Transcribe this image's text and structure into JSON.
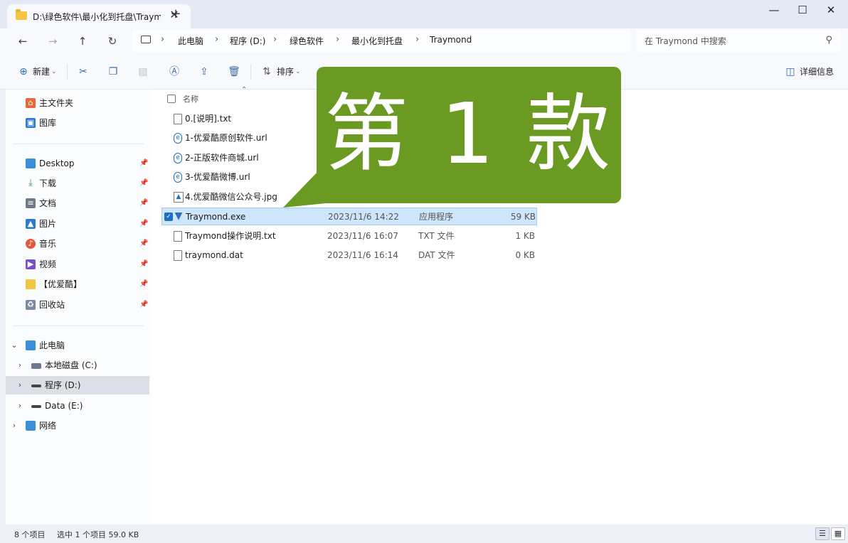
{
  "tab": {
    "title": "D:\\绿色软件\\最小化到托盘\\Traymond",
    "close": "✕",
    "new": "+"
  },
  "window": {
    "minimize": "—",
    "maximize": "☐",
    "close": "✕"
  },
  "nav": {
    "back": "←",
    "forward": "→",
    "up": "↑",
    "refresh": "↻",
    "sep": "›"
  },
  "breadcrumbs": [
    "此电脑",
    "程序 (D:)",
    "绿色软件",
    "最小化到托盘",
    "Traymond"
  ],
  "search": {
    "placeholder": "在 Traymond 中搜索",
    "icon": "⚲"
  },
  "toolbar": {
    "new_label": "新建",
    "sort_label": "排序",
    "details_label": "详细信息"
  },
  "sidebar": {
    "quick": [
      {
        "label": "主文件夹",
        "icon": "home-icon"
      },
      {
        "label": "图库",
        "icon": "gallery-icon"
      }
    ],
    "pinned": [
      {
        "label": "Desktop",
        "color": "#3a8fd8"
      },
      {
        "label": "下载",
        "color": "#2e8b57"
      },
      {
        "label": "文档",
        "color": "#6d7a8c"
      },
      {
        "label": "图片",
        "color": "#2f7ad1"
      },
      {
        "label": "音乐",
        "color": "#e2583e"
      },
      {
        "label": "视频",
        "color": "#7b4fc9"
      },
      {
        "label": "【优爱酷】",
        "color": "#f4c542"
      },
      {
        "label": "回收站",
        "color": "#7a8aa0"
      }
    ],
    "tree": [
      {
        "label": "此电脑",
        "chev": "⌄"
      },
      {
        "label": "本地磁盘 (C:)",
        "chev": "›"
      },
      {
        "label": "程序 (D:)",
        "chev": "›"
      },
      {
        "label": "Data (E:)",
        "chev": "›"
      },
      {
        "label": "网络",
        "chev": "›"
      }
    ],
    "pin_glyph": "📌"
  },
  "header": {
    "name": "名称",
    "sort_caret": "⌃"
  },
  "files": [
    {
      "name": "0.[说明].txt",
      "date": "",
      "type": "",
      "size": "",
      "icon": "txt"
    },
    {
      "name": "1-优爱酷原创软件.url",
      "date": "",
      "type": "",
      "size": "",
      "icon": "url"
    },
    {
      "name": "2-正版软件商城.url",
      "date": "",
      "type": "",
      "size": "",
      "icon": "url"
    },
    {
      "name": "3-优爱酷微博.url",
      "date": "",
      "type": "",
      "size": "",
      "icon": "url"
    },
    {
      "name": "4.优爱酷微信公众号.jpg",
      "date": "",
      "type": "",
      "size": "",
      "icon": "jpg"
    },
    {
      "name": "Traymond.exe",
      "date": "2023/11/6 14:22",
      "type": "应用程序",
      "size": "59 KB",
      "icon": "exe"
    },
    {
      "name": "Traymond操作说明.txt",
      "date": "2023/11/6 16:07",
      "type": "TXT 文件",
      "size": "1 KB",
      "icon": "txt"
    },
    {
      "name": "traymond.dat",
      "date": "2023/11/6 16:14",
      "type": "DAT 文件",
      "size": "0 KB",
      "icon": "dat"
    }
  ],
  "callout": {
    "text": "第 1 款",
    "color": "#6b9a23"
  },
  "status": {
    "count": "8 个项目",
    "selection": "选中 1 个项目  59.0 KB"
  }
}
